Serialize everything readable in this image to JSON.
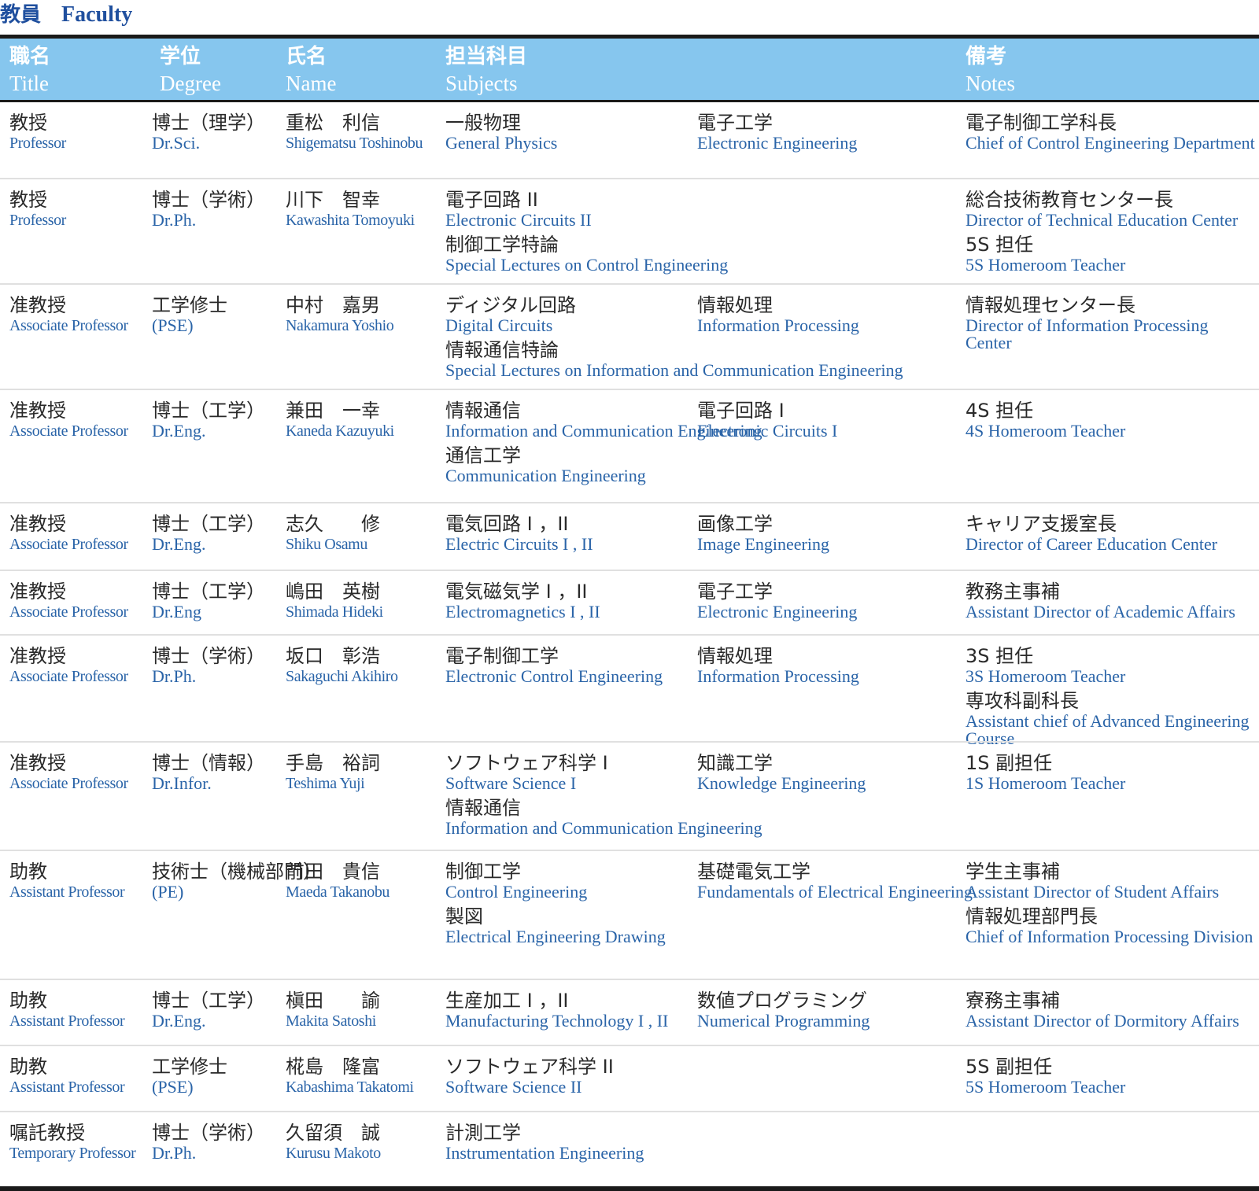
{
  "heading": {
    "jp": "教員",
    "en": "Faculty"
  },
  "columns": [
    {
      "jp": "職名",
      "en": "Title"
    },
    {
      "jp": "学位",
      "en": "Degree"
    },
    {
      "jp": "氏名",
      "en": "Name"
    },
    {
      "jp": "担当科目",
      "en": "Subjects"
    },
    {
      "jp": "備考",
      "en": "Notes"
    }
  ],
  "rows": [
    {
      "title": {
        "jp": "教授",
        "en": "Professor"
      },
      "degree": {
        "jp": "博士（理学）",
        "en": "Dr.Sci."
      },
      "name": {
        "jp": "重松　利信",
        "en": "Shigematsu Toshinobu"
      },
      "subjects_left": [
        {
          "jp": "一般物理",
          "en": "General Physics"
        }
      ],
      "subjects_right": [
        {
          "jp": "電子工学",
          "en": "Electronic Engineering"
        }
      ],
      "notes": [
        {
          "jp": "電子制御工学科長",
          "en": "Chief of Control Engineering Department"
        }
      ]
    },
    {
      "title": {
        "jp": "教授",
        "en": "Professor"
      },
      "degree": {
        "jp": "博士（学術）",
        "en": "Dr.Ph."
      },
      "name": {
        "jp": "川下　智幸",
        "en": "Kawashita Tomoyuki"
      },
      "subjects_left": [
        {
          "jp": "電子回路 II",
          "en": "Electronic Circuits  II"
        },
        {
          "jp": "制御工学特論",
          "en": "Special Lectures on Control Engineering"
        }
      ],
      "subjects_right": [],
      "notes": [
        {
          "jp": "総合技術教育センター長",
          "en": "Director of Technical Education Center"
        },
        {
          "jp": "5S 担任",
          "en": "5S Homeroom Teacher"
        }
      ]
    },
    {
      "title": {
        "jp": "准教授",
        "en": "Associate Professor"
      },
      "degree": {
        "jp": "工学修士",
        "en": "(PSE)"
      },
      "name": {
        "jp": "中村　嘉男",
        "en": "Nakamura Yoshio"
      },
      "subjects_left": [
        {
          "jp": "ディジタル回路",
          "en": "Digital Circuits"
        },
        {
          "jp": "情報通信特論",
          "en": "Special Lectures on Information and Communication Engineering"
        }
      ],
      "subjects_right": [
        {
          "jp": "情報処理",
          "en": "Information Processing"
        }
      ],
      "notes": [
        {
          "jp": "情報処理センター長",
          "en": "Director of Information Processing Center"
        }
      ]
    },
    {
      "title": {
        "jp": "准教授",
        "en": "Associate Professor"
      },
      "degree": {
        "jp": "博士（工学）",
        "en": "Dr.Eng."
      },
      "name": {
        "jp": "兼田　一幸",
        "en": "Kaneda Kazuyuki"
      },
      "subjects_left": [
        {
          "jp": "情報通信",
          "en": "Information and Communication Engineering"
        },
        {
          "jp": "通信工学",
          "en": "Communication Engineering"
        }
      ],
      "subjects_right": [
        {
          "jp": "電子回路 I",
          "en": "Electronic Circuits  I"
        }
      ],
      "notes": [
        {
          "jp": "4S 担任",
          "en": "4S Homeroom Teacher"
        }
      ]
    },
    {
      "title": {
        "jp": "准教授",
        "en": "Associate Professor"
      },
      "degree": {
        "jp": "博士（工学）",
        "en": "Dr.Eng."
      },
      "name": {
        "jp": "志久　　修",
        "en": "Shiku Osamu"
      },
      "subjects_left": [
        {
          "jp": "電気回路 I ，II",
          "en": "Electric Circuits  I , II"
        }
      ],
      "subjects_right": [
        {
          "jp": "画像工学",
          "en": "Image Engineering"
        }
      ],
      "notes": [
        {
          "jp": "キャリア支援室長",
          "en": "Director of Career Education Center"
        }
      ]
    },
    {
      "title": {
        "jp": "准教授",
        "en": "Associate Professor"
      },
      "degree": {
        "jp": "博士（工学）",
        "en": "Dr.Eng"
      },
      "name": {
        "jp": "嶋田　英樹",
        "en": "Shimada Hideki"
      },
      "subjects_left": [
        {
          "jp": "電気磁気学 I ，II",
          "en": "Electromagnetics  I , II"
        }
      ],
      "subjects_right": [
        {
          "jp": "電子工学",
          "en": "Electronic Engineering"
        }
      ],
      "notes": [
        {
          "jp": "教務主事補",
          "en": "Assistant Director of Academic Affairs"
        }
      ]
    },
    {
      "title": {
        "jp": "准教授",
        "en": "Associate Professor"
      },
      "degree": {
        "jp": "博士（学術）",
        "en": "Dr.Ph."
      },
      "name": {
        "jp": "坂口　彰浩",
        "en": "Sakaguchi Akihiro"
      },
      "subjects_left": [
        {
          "jp": "電子制御工学",
          "en": "Electronic Control Engineering"
        }
      ],
      "subjects_right": [
        {
          "jp": "情報処理",
          "en": "Information Processing"
        }
      ],
      "notes": [
        {
          "jp": "3S 担任",
          "en": "3S Homeroom Teacher"
        },
        {
          "jp": "専攻科副科長",
          "en": "Assistant chief of Advanced Engineering Course"
        }
      ]
    },
    {
      "title": {
        "jp": "准教授",
        "en": "Associate Professor"
      },
      "degree": {
        "jp": "博士（情報）",
        "en": "Dr.Infor."
      },
      "name": {
        "jp": "手島　裕詞",
        "en": "Teshima Yuji"
      },
      "subjects_left": [
        {
          "jp": "ソフトウェア科学 I",
          "en": "Software Science  I"
        },
        {
          "jp": "情報通信",
          "en": "Information and Communication Engineering"
        }
      ],
      "subjects_right": [
        {
          "jp": "知識工学",
          "en": "Knowledge Engineering"
        }
      ],
      "notes": [
        {
          "jp": "1S 副担任",
          "en": "1S Homeroom Teacher"
        }
      ]
    },
    {
      "title": {
        "jp": "助教",
        "en": "Assistant Professor"
      },
      "degree": {
        "jp": "技術士（機械部門）",
        "en": "(PE)"
      },
      "name": {
        "jp": "前田　貴信",
        "en": "Maeda Takanobu"
      },
      "subjects_left": [
        {
          "jp": "制御工学",
          "en": "Control Engineering"
        },
        {
          "jp": "製図",
          "en": "Electrical Engineering Drawing"
        }
      ],
      "subjects_right": [
        {
          "jp": "基礎電気工学",
          "en": "Fundamentals of Electrical Engineering"
        }
      ],
      "notes": [
        {
          "jp": "学生主事補",
          "en": "Assistant Director of Student Affairs"
        },
        {
          "jp": "情報処理部門長",
          "en": "Chief of Information Processing Division"
        }
      ]
    },
    {
      "title": {
        "jp": "助教",
        "en": "Assistant Professor"
      },
      "degree": {
        "jp": "博士（工学）",
        "en": "Dr.Eng."
      },
      "name": {
        "jp": "槇田　　諭",
        "en": "Makita Satoshi"
      },
      "subjects_left": [
        {
          "jp": "生産加工 I ，II",
          "en": "Manufacturing Technology  I , II"
        }
      ],
      "subjects_right": [
        {
          "jp": "数値プログラミング",
          "en": "Numerical Programming"
        }
      ],
      "notes": [
        {
          "jp": "寮務主事補",
          "en": "Assistant Director of Dormitory Affairs"
        }
      ]
    },
    {
      "title": {
        "jp": "助教",
        "en": "Assistant Professor"
      },
      "degree": {
        "jp": "工学修士",
        "en": "(PSE)"
      },
      "name": {
        "jp": "椛島　隆富",
        "en": "Kabashima Takatomi"
      },
      "subjects_left": [
        {
          "jp": "ソフトウェア科学 II",
          "en": "Software Science  II"
        }
      ],
      "subjects_right": [],
      "notes": [
        {
          "jp": "5S 副担任",
          "en": "5S Homeroom Teacher"
        }
      ]
    },
    {
      "title": {
        "jp": "嘱託教授",
        "en": "Temporary Professor"
      },
      "degree": {
        "jp": "博士（学術）",
        "en": "Dr.Ph."
      },
      "name": {
        "jp": "久留須　誠",
        "en": "Kurusu Makoto"
      },
      "subjects_left": [
        {
          "jp": "計測工学",
          "en": "Instrumentation Engineering"
        }
      ],
      "subjects_right": [],
      "notes": []
    }
  ]
}
